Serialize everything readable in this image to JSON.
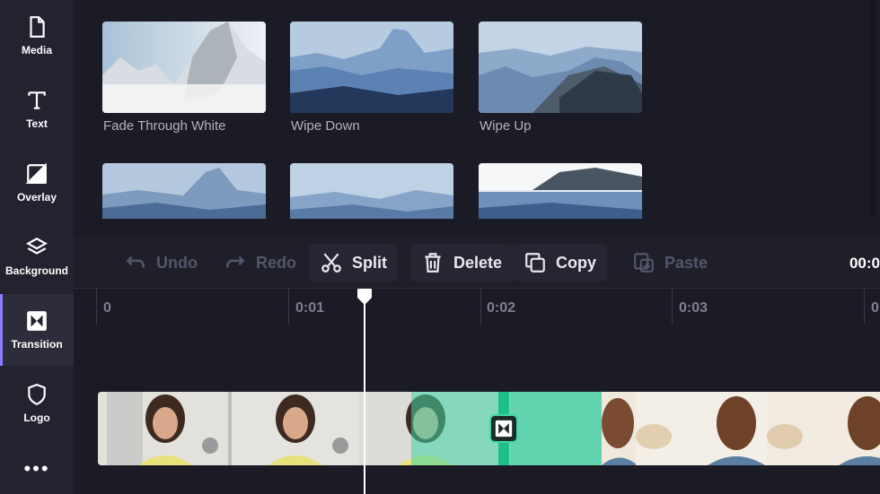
{
  "sidebar": {
    "items": [
      {
        "label": "Media",
        "icon": "file-icon"
      },
      {
        "label": "Text",
        "icon": "text-icon"
      },
      {
        "label": "Overlay",
        "icon": "overlay-icon"
      },
      {
        "label": "Background",
        "icon": "layers-icon"
      },
      {
        "label": "Transition",
        "icon": "transition-icon",
        "active": true
      },
      {
        "label": "Logo",
        "icon": "shield-icon"
      }
    ],
    "more": "•••"
  },
  "transitions": [
    {
      "label": "Fade Through White"
    },
    {
      "label": "Wipe Down"
    },
    {
      "label": "Wipe Up"
    }
  ],
  "toolbar": {
    "undo": "Undo",
    "redo": "Redo",
    "split": "Split",
    "delete": "Delete",
    "copy": "Copy",
    "paste": "Paste",
    "timecode": "00:0"
  },
  "ruler": {
    "labels": [
      "0",
      "0:01",
      "0:02",
      "0:03",
      "0"
    ]
  },
  "colors": {
    "accent": "#8c7bff",
    "transition_teal": "#3fd6a8"
  }
}
